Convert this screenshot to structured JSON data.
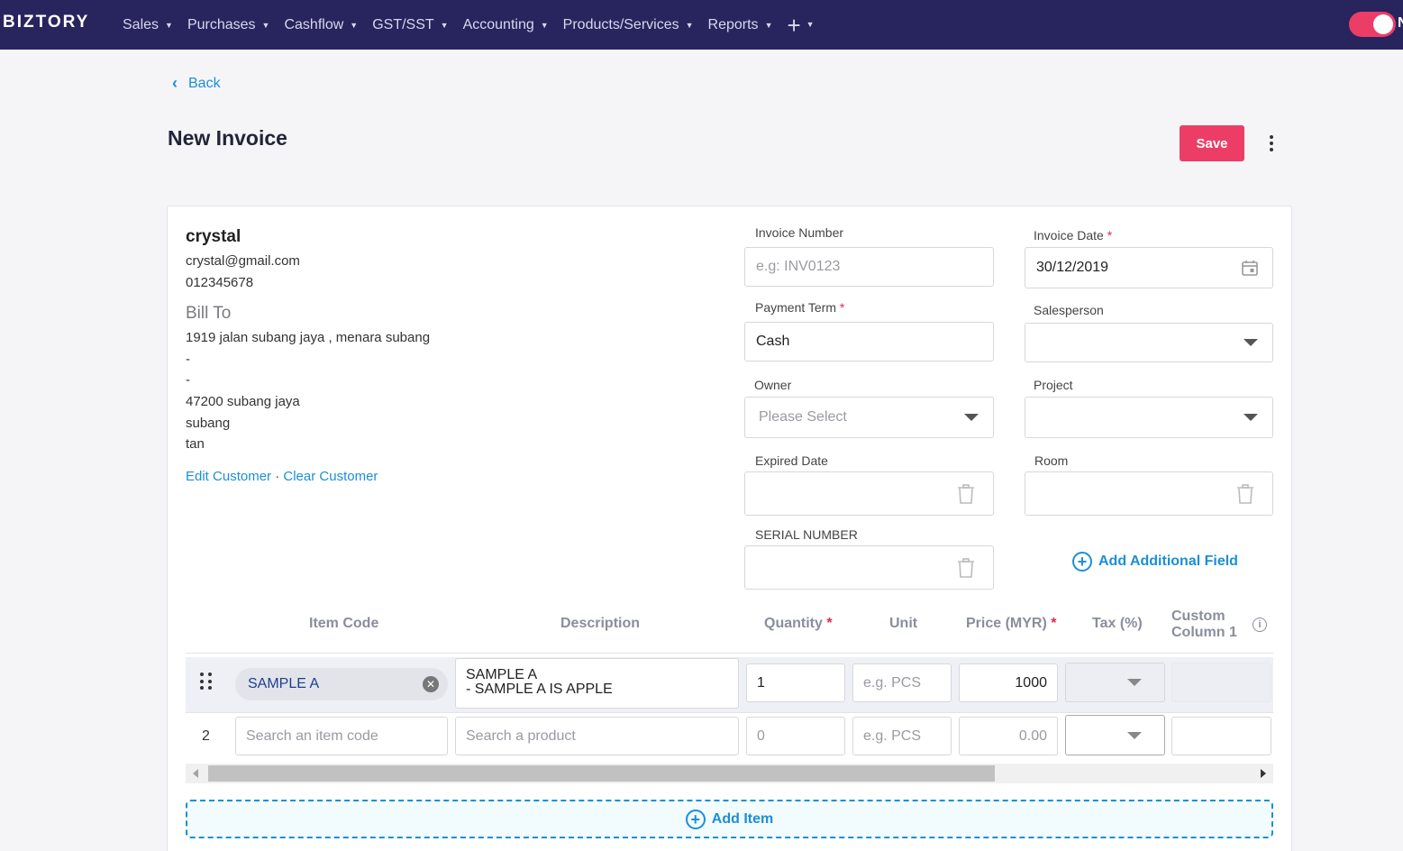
{
  "nav": {
    "brand": "BIZTORY",
    "items": [
      "Sales",
      "Purchases",
      "Cashflow",
      "GST/SST",
      "Accounting",
      "Products/Services",
      "Reports"
    ],
    "plus": "+",
    "truncated_label": "N"
  },
  "header": {
    "back_label": "Back",
    "title": "New Invoice",
    "save_label": "Save"
  },
  "customer": {
    "name": "crystal",
    "email": "crystal@gmail.com",
    "phone": "012345678",
    "bill_to_label": "Bill To",
    "address_lines": [
      "1919 jalan subang jaya , menara subang",
      "-",
      "-",
      "47200 subang jaya",
      "subang",
      "tan"
    ],
    "edit_label": "Edit Customer",
    "separator": "·",
    "clear_label": "Clear Customer"
  },
  "fields": {
    "invoice_number": {
      "label": "Invoice Number",
      "placeholder": "e.g: INV0123",
      "value": ""
    },
    "invoice_date": {
      "label": "Invoice Date",
      "required": "*",
      "value": "30/12/2019"
    },
    "payment_term": {
      "label": "Payment Term",
      "required": "*",
      "value": "Cash"
    },
    "salesperson": {
      "label": "Salesperson",
      "value": ""
    },
    "owner": {
      "label": "Owner",
      "placeholder": "Please Select"
    },
    "project": {
      "label": "Project",
      "value": ""
    },
    "expired_date": {
      "label": "Expired Date",
      "value": ""
    },
    "room": {
      "label": "Room",
      "value": ""
    },
    "serial_number": {
      "label": "SERIAL NUMBER",
      "value": ""
    },
    "add_additional_label": "Add Additional Field"
  },
  "table": {
    "headers": {
      "item_code": "Item Code",
      "description": "Description",
      "quantity": "Quantity",
      "unit": "Unit",
      "price": "Price (MYR)",
      "tax": "Tax (%)",
      "custom_line1": "Custom",
      "custom_line2": "Column 1",
      "required": "*"
    },
    "rows": [
      {
        "item_code": "SAMPLE A",
        "description_line1": "SAMPLE A",
        "description_line2": "- SAMPLE A IS APPLE",
        "quantity": "1",
        "unit_placeholder": "e.g. PCS",
        "price": "1000"
      },
      {
        "number": "2",
        "item_code_placeholder": "Search an item code",
        "description_placeholder": "Search a product",
        "quantity_placeholder": "0",
        "unit_placeholder": "e.g. PCS",
        "price_placeholder": "0.00"
      }
    ],
    "add_item_label": "Add Item"
  },
  "colors": {
    "navbar": "#27245e",
    "accent": "#ec3d67",
    "link": "#1b8fd6"
  }
}
